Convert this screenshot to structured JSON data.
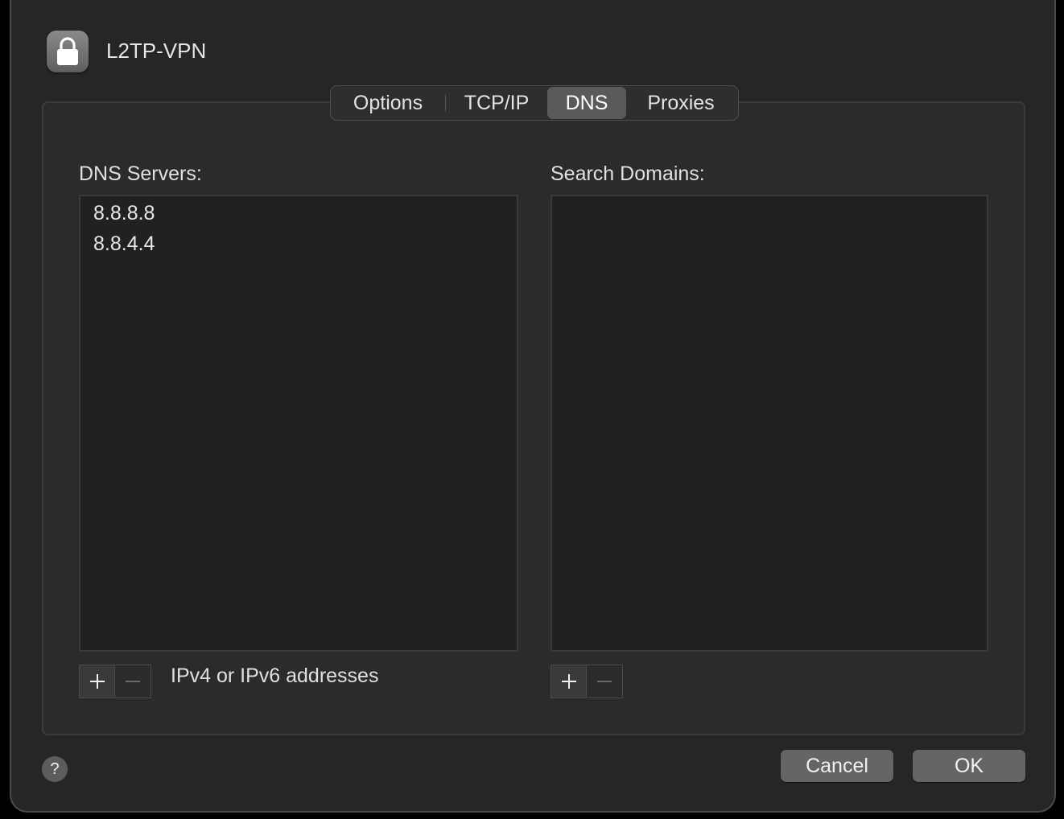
{
  "window": {
    "title": "L2TP-VPN",
    "icon": "lock-icon"
  },
  "tabs": [
    {
      "label": "Options",
      "selected": false
    },
    {
      "label": "TCP/IP",
      "selected": false
    },
    {
      "label": "DNS",
      "selected": true
    },
    {
      "label": "Proxies",
      "selected": false
    }
  ],
  "dns_servers": {
    "label": "DNS Servers:",
    "items": [
      "8.8.8.8",
      "8.8.4.4"
    ],
    "add_icon": "plus-icon",
    "remove_icon": "minus-icon",
    "hint": "IPv4 or IPv6 addresses"
  },
  "search_domains": {
    "label": "Search Domains:",
    "items": [],
    "add_icon": "plus-icon",
    "remove_icon": "minus-icon"
  },
  "footer": {
    "help_label": "?",
    "cancel_label": "Cancel",
    "ok_label": "OK"
  },
  "colors": {
    "sheet_background": "#262626",
    "selected_tab": "#5a5a5a",
    "button": "#656565"
  }
}
